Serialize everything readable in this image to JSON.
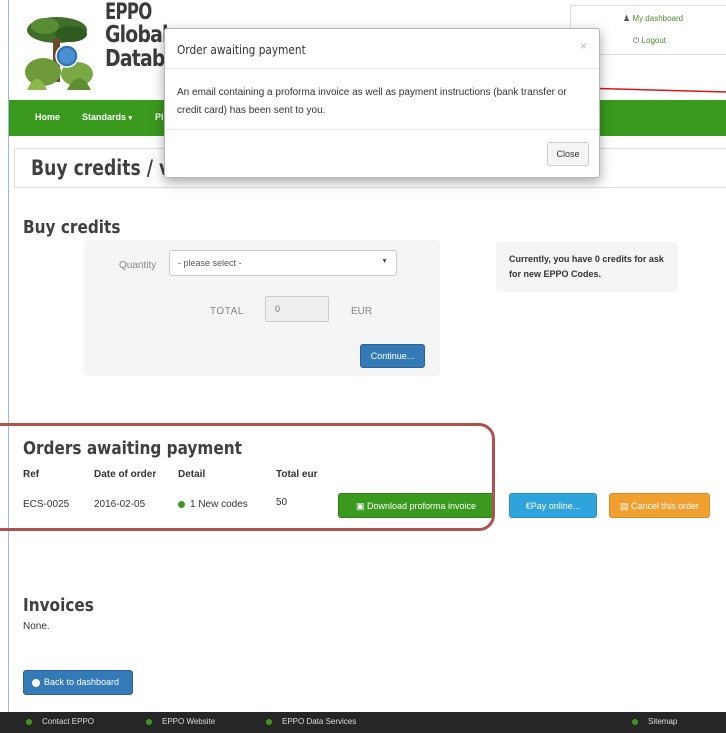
{
  "header": {
    "logo_line1": "EPPO",
    "logo_line2": "Global",
    "logo_line3": "Datab",
    "dashboard_link": "My dashboard",
    "logout_link": "Logout"
  },
  "nav": {
    "items": [
      "Home",
      "Standards",
      "Pl"
    ]
  },
  "page": {
    "title": "Buy credits / vi"
  },
  "buy_credits": {
    "title": "Buy credits",
    "quantity_label": "Quantity",
    "quantity_value": "- please select -",
    "total_label": "TOTAL",
    "total_value": "0",
    "currency": "EUR",
    "continue_label": "Continue...",
    "credits_info": "Currently, you have 0 credits for ask for new EPPO Codes."
  },
  "orders": {
    "title": "Orders awaiting payment",
    "columns": [
      "Ref",
      "Date of order",
      "Detail",
      "Total eur"
    ],
    "rows": [
      {
        "ref": "ECS-0025",
        "date": "2016-02-05",
        "detail": "1 New codes",
        "total": "50",
        "download_label": "Download proforma invoice",
        "pay_label": "Pay online...",
        "cancel_label": "Cancel this order"
      }
    ]
  },
  "invoices": {
    "title": "Invoices",
    "empty_text": "None.",
    "back_label": "Back to dashboard"
  },
  "footer": {
    "contact": "Contact EPPO",
    "website": "EPPO Website",
    "data_services": "EPPO Data Services",
    "sitemap": "Sitemap"
  },
  "modal": {
    "title": "Order awaiting payment",
    "close_icon": "×",
    "body": "An email containing a proforma invoice as well as payment instructions (bank transfer or credit card) has been sent to you.",
    "close_label": "Close"
  },
  "colors": {
    "brand_green": "#3a9a1e",
    "primary_blue": "#337ab7",
    "info_blue": "#2ea3dc",
    "warning_orange": "#f0a030",
    "highlight_red": "#b05050"
  }
}
